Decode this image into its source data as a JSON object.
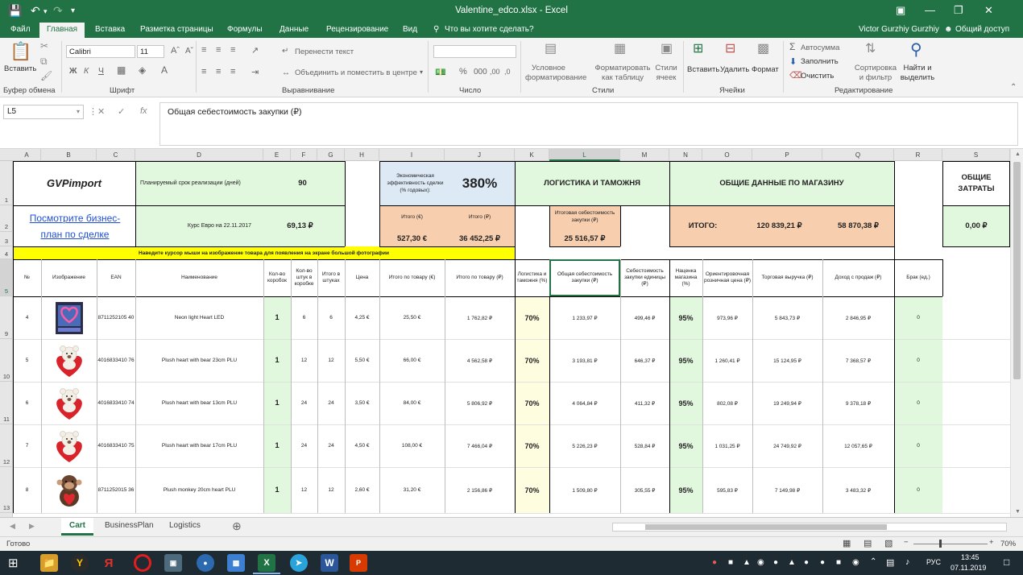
{
  "window": {
    "title": "Valentine_edco.xlsx - Excel"
  },
  "menu": {
    "tabs": [
      "Файл",
      "Главная",
      "Вставка",
      "Разметка страницы",
      "Формулы",
      "Данные",
      "Рецензирование",
      "Вид"
    ],
    "tell_me": "Что вы хотите сделать?",
    "user": "Victor Gurzhiy Gurzhiy",
    "share": "Общий доступ"
  },
  "ribbon": {
    "paste": "Вставить",
    "clipboard_group": "Буфер обмена",
    "font_name": "Calibri",
    "font_size": "11",
    "font_group": "Шрифт",
    "wrap_text": "Перенести текст",
    "merge_center": "Объединить и поместить в центре",
    "alignment_group": "Выравнивание",
    "number_group": "Число",
    "cond_format": "Условное форматирование",
    "format_table": "Форматировать как таблицу",
    "cell_styles": "Стили ячеек",
    "styles_group": "Стили",
    "insert": "Вставить",
    "delete": "Удалить",
    "format": "Формат",
    "cells_group": "Ячейки",
    "autosum": "Автосумма",
    "fill": "Заполнить",
    "clear": "Очистить",
    "sort_filter": "Сортировка и фильтр",
    "find_select": "Найти и выделить",
    "editing_group": "Редактирование"
  },
  "formula_bar": {
    "name_box": "L5",
    "formula": "Общая себестоимость закупки (₽)"
  },
  "columns": [
    "A",
    "B",
    "C",
    "D",
    "E",
    "F",
    "G",
    "H",
    "I",
    "J",
    "K",
    "L",
    "M",
    "N",
    "O",
    "P",
    "Q",
    "R",
    "S"
  ],
  "selected_column": "L",
  "rows": [
    "1",
    "2",
    "3",
    "4",
    "5",
    "9",
    "10",
    "11",
    "12",
    "13"
  ],
  "selected_row": "5",
  "sheet": {
    "company": "GVPimport",
    "business_link": "Посмотрите бизнес-план по сделке",
    "planned_days_label": "Планируемый срок реализации (дней)",
    "planned_days": "90",
    "euro_rate_label": "Курс Евро на 22.11.2017",
    "euro_rate": "69,13 ₽",
    "efficiency_label": "Экономическая эффективность сделки (% годовых):",
    "efficiency": "380%",
    "total_eur_label": "Итого (€)",
    "total_eur": "527,30 €",
    "total_rub_label": "Итого (₽)",
    "total_rub": "36 452,25 ₽",
    "logistics_title": "ЛОГИСТИКА И ТАМОЖНЯ",
    "total_cost_label": "Итоговая себестоимость закупки (₽)",
    "total_cost": "25 516,57 ₽",
    "store_title": "ОБЩИЕ ДАННЫЕ ПО МАГАЗИНУ",
    "store_total_label": "ИТОГО:",
    "store_revenue": "120 839,21 ₽",
    "store_income": "58 870,38 ₽",
    "costs_title": "ОБЩИЕ ЗАТРАТЫ",
    "costs_value": "0,00 ₽",
    "hover_hint": "Наведите курсор мыши на изображение товара для появления на экране большой фотографии",
    "headers": [
      "№",
      "Изображение",
      "EAN",
      "Наименование",
      "Кол-во коробок",
      "Кол-во штук в коробке",
      "Итого в штуках",
      "Цена",
      "Итого по товару (€)",
      "Итого по товару (₽)",
      "Логистика и таможня (%)",
      "Общая себестоимость закупки (₽)",
      "Себестоимость закупки единицы (₽)",
      "Наценка магазина (%)",
      "Ориентировочная розничная цена (₽)",
      "Торговая выручка (₽)",
      "Доход с продаж (₽)",
      "Брак (ед.)"
    ],
    "items": [
      {
        "n": "4",
        "image": "neon-heart",
        "ean": "8711252105 40",
        "name": "Neon light Heart LED",
        "boxes": "1",
        "per_box": "6",
        "pieces": "6",
        "price": "4,25 €",
        "total_eur": "25,50 €",
        "total_rub": "1 762,82 ₽",
        "logistics": "70%",
        "total_cost": "1 233,97 ₽",
        "unit_cost": "499,46 ₽",
        "markup": "95%",
        "retail": "973,96 ₽",
        "revenue": "5 843,73 ₽",
        "income": "2 846,95 ₽",
        "defect": "0"
      },
      {
        "n": "5",
        "image": "bear-heart",
        "ean": "4016833410 76",
        "name": "Plush heart with bear 23cm PLU",
        "boxes": "1",
        "per_box": "12",
        "pieces": "12",
        "price": "5,50 €",
        "total_eur": "66,00 €",
        "total_rub": "4 562,58 ₽",
        "logistics": "70%",
        "total_cost": "3 193,81 ₽",
        "unit_cost": "646,37 ₽",
        "markup": "95%",
        "retail": "1 260,41 ₽",
        "revenue": "15 124,95 ₽",
        "income": "7 368,57 ₽",
        "defect": "0"
      },
      {
        "n": "6",
        "image": "bear-heart",
        "ean": "4016833410 74",
        "name": "Plush heart with bear 13cm PLU",
        "boxes": "1",
        "per_box": "24",
        "pieces": "24",
        "price": "3,50 €",
        "total_eur": "84,00 €",
        "total_rub": "5 806,92 ₽",
        "logistics": "70%",
        "total_cost": "4 064,84 ₽",
        "unit_cost": "411,32 ₽",
        "markup": "95%",
        "retail": "802,08 ₽",
        "revenue": "19 249,94 ₽",
        "income": "9 378,18 ₽",
        "defect": "0"
      },
      {
        "n": "7",
        "image": "bear-heart",
        "ean": "4016833410 75",
        "name": "Plush heart with bear 17cm PLU",
        "boxes": "1",
        "per_box": "24",
        "pieces": "24",
        "price": "4,50 €",
        "total_eur": "108,00 €",
        "total_rub": "7 466,04 ₽",
        "logistics": "70%",
        "total_cost": "5 226,23 ₽",
        "unit_cost": "528,84 ₽",
        "markup": "95%",
        "retail": "1 031,25 ₽",
        "revenue": "24 749,92 ₽",
        "income": "12 057,65 ₽",
        "defect": "0"
      },
      {
        "n": "8",
        "image": "monkey-heart",
        "ean": "8711252015 36",
        "name": "Plush monkey 20cm heart PLU",
        "boxes": "1",
        "per_box": "12",
        "pieces": "12",
        "price": "2,60 €",
        "total_eur": "31,20 €",
        "total_rub": "2 156,86 ₽",
        "logistics": "70%",
        "total_cost": "1 509,80 ₽",
        "unit_cost": "305,55 ₽",
        "markup": "95%",
        "retail": "595,83 ₽",
        "revenue": "7 149,98 ₽",
        "income": "3 483,32 ₽",
        "defect": "0"
      }
    ]
  },
  "sheet_tabs": [
    "Cart",
    "BusinessPlan",
    "Logistics"
  ],
  "active_tab": "Cart",
  "status": {
    "ready": "Готово",
    "zoom": "70%"
  },
  "taskbar": {
    "time": "13:45",
    "date": "07.11.2019",
    "lang": "РУС"
  },
  "colors": {
    "excel_green": "#217346",
    "light_green": "#e2f8de",
    "light_blue": "#dde9f5",
    "peach": "#f7ceae",
    "yellow": "#ffff00",
    "light_yellow": "#fffde0"
  }
}
